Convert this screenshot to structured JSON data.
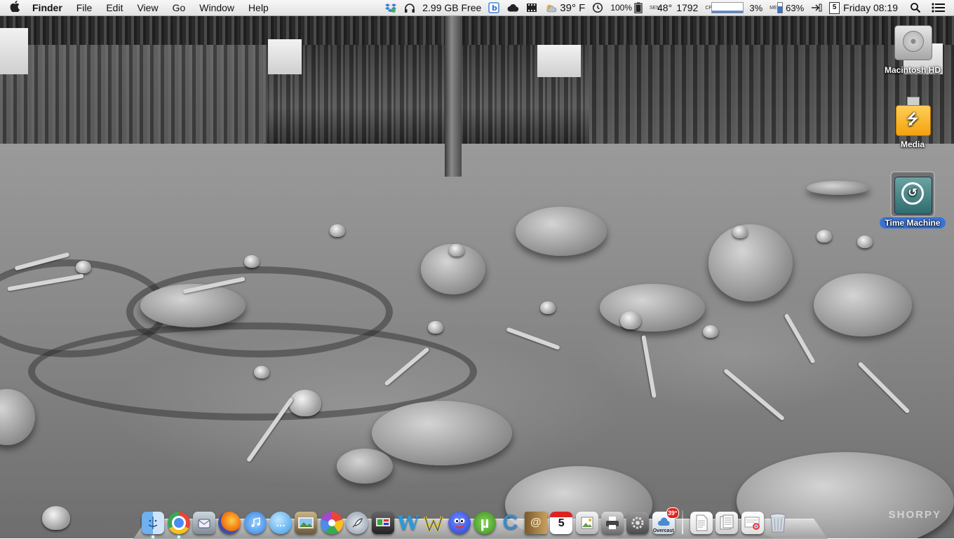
{
  "menubar": {
    "apple_icon": "apple-logo",
    "app_name": "Finder",
    "menus": [
      "File",
      "Edit",
      "View",
      "Go",
      "Window",
      "Help"
    ],
    "status": {
      "disk_free": "2.99 GB Free",
      "weather_temp": "39° F",
      "battery_percent": "100%",
      "altitude_temp": "48°",
      "fan_rpm": "1792",
      "cpu_percent": "3%",
      "memory_percent": "63%",
      "calendar_day": "5",
      "clock": "Friday 08:19"
    },
    "icons": [
      "dropbox-icon",
      "headphones-icon",
      "b-icon",
      "cloud-icon",
      "film-icon",
      "weather-icon",
      "time-machine-icon",
      "battery-icon",
      "input-icon",
      "calendar-icon",
      "spotlight-icon",
      "notification-center-icon"
    ]
  },
  "desktop": {
    "icons": [
      {
        "label": "Macintosh HD",
        "icon": "hard-drive-icon"
      },
      {
        "label": "Media",
        "icon": "usb-drive-icon"
      },
      {
        "label": "Time Machine",
        "icon": "time-machine-drive-icon",
        "selected": true
      }
    ],
    "watermark": "SHORPY"
  },
  "dock": {
    "apps": [
      {
        "name": "Finder",
        "icon": "finder-icon",
        "color": "#4a8fe0",
        "running": true
      },
      {
        "name": "Chrome",
        "icon": "chrome-icon",
        "color": "#e8453c",
        "running": true
      },
      {
        "name": "Mail Stamp",
        "icon": "mailbox-icon",
        "color": "#8a9aa8"
      },
      {
        "name": "Firefox",
        "icon": "firefox-icon",
        "color": "#e66000"
      },
      {
        "name": "iTunes",
        "icon": "itunes-icon",
        "color": "#2f7fe0"
      },
      {
        "name": "Messages",
        "icon": "messages-icon",
        "color": "#5aaff0"
      },
      {
        "name": "iPhoto",
        "icon": "iphoto-icon",
        "color": "#7a6a4a"
      },
      {
        "name": "Picasa",
        "icon": "picasa-icon",
        "color": "#44a844"
      },
      {
        "name": "Rocket",
        "icon": "rocket-icon",
        "color": "#9aa4b0"
      },
      {
        "name": "Media Center",
        "icon": "media-center-icon",
        "color": "#555"
      },
      {
        "name": "W",
        "icon": "w-icon",
        "color": "#2a9ad8",
        "glyph": "W"
      },
      {
        "name": "Wunderlist",
        "icon": "wunderlist-icon",
        "color": "#2a5ab8"
      },
      {
        "name": "Adium",
        "icon": "adium-icon",
        "color": "#3a5ae0"
      },
      {
        "name": "uTorrent",
        "icon": "utorrent-icon",
        "color": "#5aa83a",
        "glyph": "µ"
      },
      {
        "name": "Cyberduck",
        "icon": "c-icon",
        "color": "#3a8ac8",
        "glyph": "C"
      },
      {
        "name": "Contacts",
        "icon": "address-book-icon",
        "color": "#a07840"
      },
      {
        "name": "Calendar",
        "icon": "calendar-app-icon",
        "color": "#ffffff",
        "glyph": "5"
      },
      {
        "name": "Preview",
        "icon": "preview-icon",
        "color": "#c8c8c8"
      },
      {
        "name": "Printer",
        "icon": "printer-icon",
        "color": "#a0a0a0"
      },
      {
        "name": "System Preferences",
        "icon": "system-preferences-icon",
        "color": "#8a8a8a"
      },
      {
        "name": "Overcast",
        "icon": "overcast-icon",
        "color": "#e8e8e8",
        "badge": "39°",
        "label": "Overcast"
      }
    ],
    "stacks": [
      {
        "name": "Document",
        "icon": "document-stack-icon",
        "color": "#f0f0f0"
      },
      {
        "name": "Downloads",
        "icon": "downloads-stack-icon",
        "color": "#e8e8e8"
      },
      {
        "name": "Chrome file",
        "icon": "chrome-file-icon",
        "color": "#f4f4f4"
      },
      {
        "name": "Trash",
        "icon": "trash-icon",
        "color": "#b8c0c8"
      }
    ]
  }
}
